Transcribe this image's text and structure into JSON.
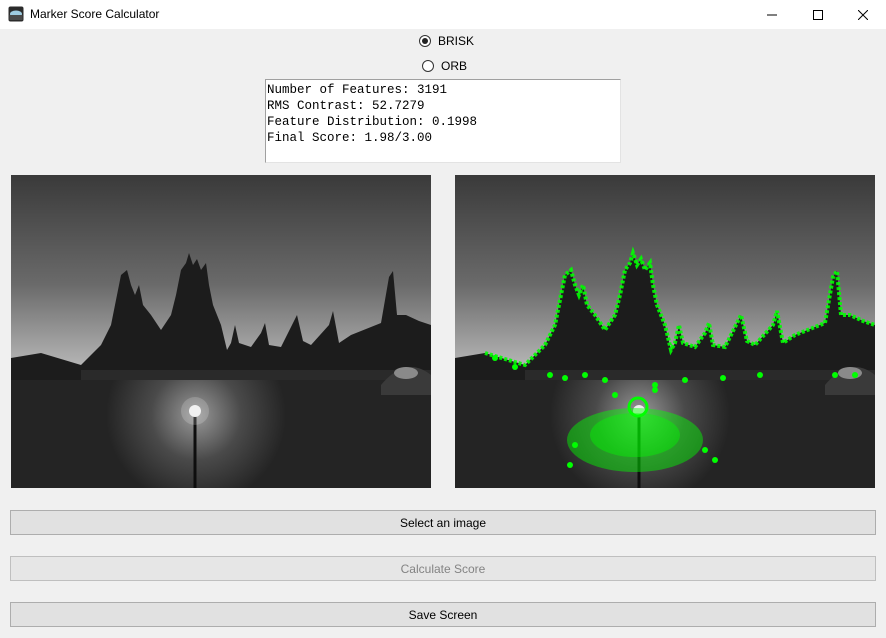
{
  "window": {
    "title": "Marker Score Calculator",
    "icon": "app-icon",
    "controls": [
      "minimize-icon",
      "maximize-icon",
      "close-icon"
    ]
  },
  "algorithm": {
    "options": [
      {
        "label": "BRISK",
        "selected": true
      },
      {
        "label": "ORB",
        "selected": false
      }
    ]
  },
  "results": {
    "lines": [
      "Number of Features: 3191",
      "RMS Contrast: 52.7279",
      "Feature Distribution: 0.1998",
      "Final Score: 1.98/3.00"
    ]
  },
  "images": {
    "original_alt": "grayscale photo of gothic college building with spires behind stone wall and lit street lamp at dusk",
    "keypoints_alt": "same photo with green keypoint markers along spires, rooftop and lamp-lit wall",
    "keypoint_color": "#00ff00"
  },
  "buttons": {
    "select": "Select an image",
    "calculate": "Calculate Score",
    "calculate_disabled": true,
    "save": "Save Screen"
  }
}
